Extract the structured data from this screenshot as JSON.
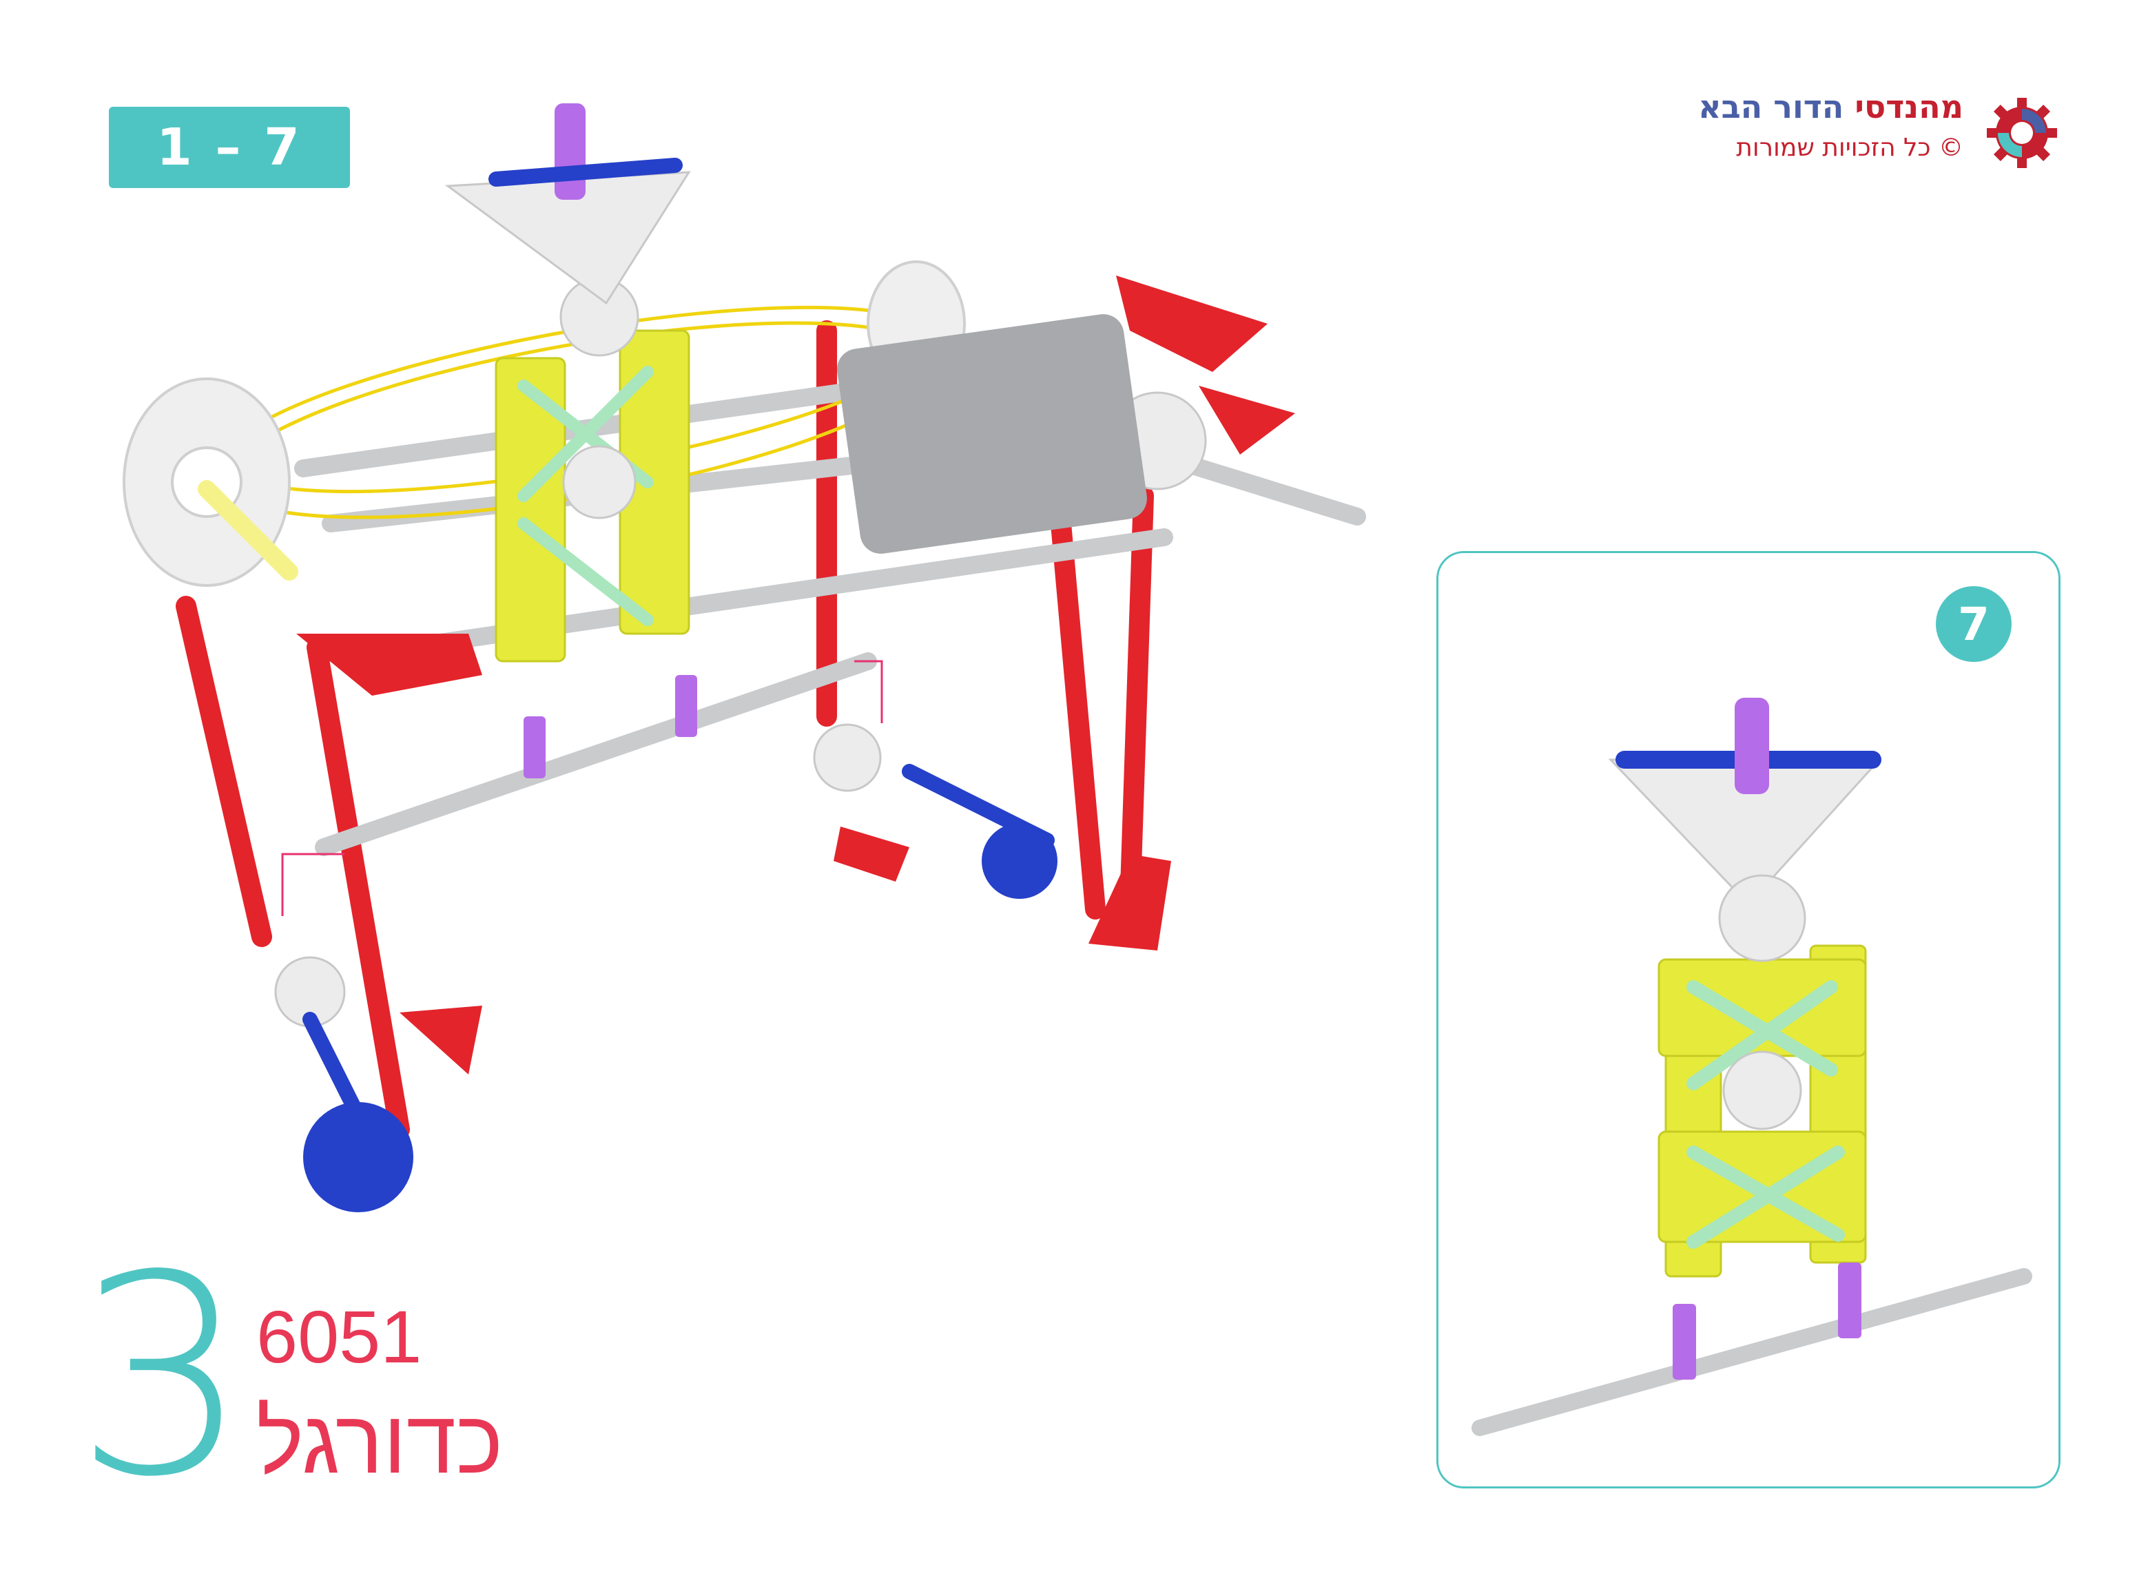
{
  "step_range": "1 – 7",
  "brand": {
    "title_part1": "מהנדסי",
    "title_part2": "הדור הבא",
    "copyright": "© כל הזכויות שמורות"
  },
  "detail": {
    "step_number": "7"
  },
  "footer": {
    "big_number": "3",
    "model_code": "6051",
    "model_name": "כדורגל"
  },
  "colors": {
    "accent": "#4fc5c3",
    "red": "#e3242b",
    "blue": "#2540c9",
    "yellow": "#e5ea3b",
    "purple": "#b56ce8",
    "grey": "#a7a9ac",
    "white_part": "#ececec",
    "green": "#a9e6bd",
    "title_red": "#e83855"
  },
  "icons": [
    "gear-logo-icon"
  ]
}
